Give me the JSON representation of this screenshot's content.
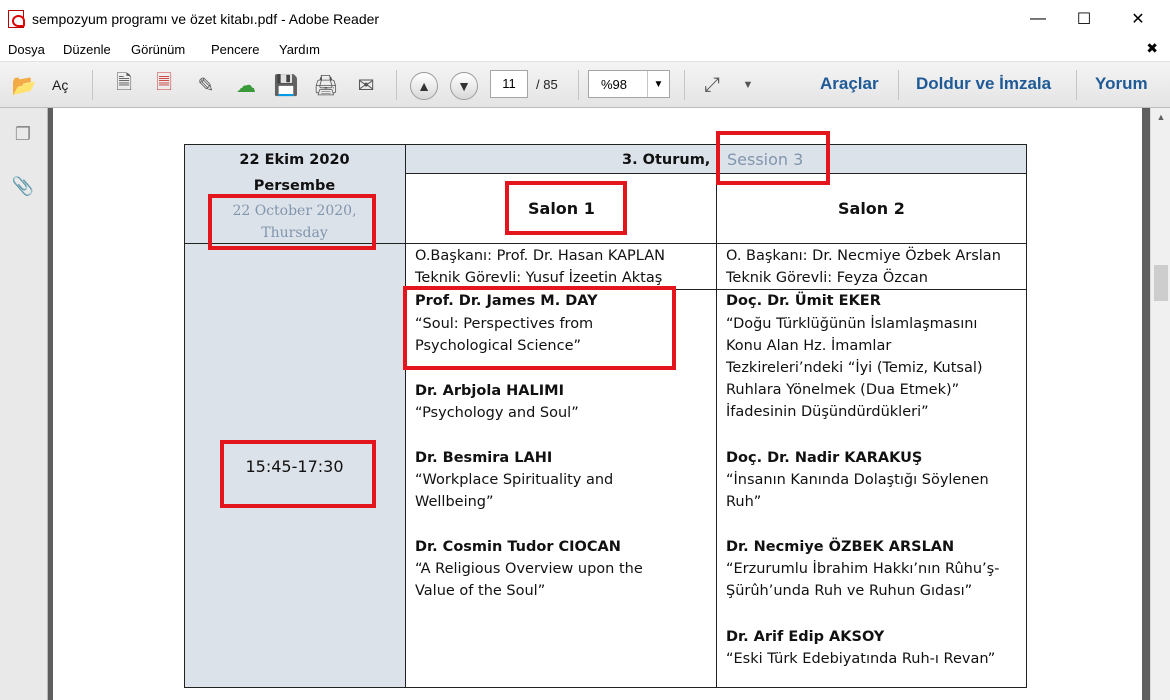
{
  "window": {
    "title": "sempozyum programı ve özet kitabı.pdf - Adobe Reader",
    "minimize": "—",
    "maximize": "☐",
    "close": "✕"
  },
  "menu": {
    "items": [
      "Dosya",
      "Düzenle",
      "Görünüm",
      "Pencere",
      "Yardım"
    ],
    "close_doc": "✖"
  },
  "toolbar": {
    "open_label": "Aç",
    "page_current": "11",
    "page_total": "/ 85",
    "zoom": "%98",
    "tools": "Araçlar",
    "fill_sign": "Doldur ve İmzala",
    "comment": "Yorum"
  },
  "table": {
    "date_line1": "22 Ekim 2020",
    "date_line2": "Persembe",
    "date_en_line1": "22 October 2020,",
    "date_en_line2": "Thursday",
    "session": "3. Oturum,",
    "session_en": "Session 3",
    "salon1": "Salon 1",
    "salon2": "Salon 2",
    "time": "15:45-17:30",
    "salon1_chair": "O.Başkanı: Prof. Dr. Hasan KAPLAN",
    "salon1_tech": "Teknik Görevli: Yusuf İzeetin Aktaş",
    "salon2_chair": "O. Başkanı: Dr. Necmiye Özbek Arslan",
    "salon2_tech": "Teknik Görevli: Feyza Özcan",
    "salon1_talks": [
      {
        "speaker": "Prof. Dr. James M. DAY",
        "title_lines": [
          "“Soul: Perspectives from",
          "Psychological Science”"
        ]
      },
      {
        "speaker": "Dr. Arbjola HALIMI",
        "title_lines": [
          "“Psychology and Soul”"
        ]
      },
      {
        "speaker": "Dr. Besmira LAHI",
        "title_lines": [
          "“Workplace Spirituality and",
          "Wellbeing”"
        ]
      },
      {
        "speaker": "Dr. Cosmin Tudor CIOCAN",
        "title_lines": [
          "“A Religious Overview upon the",
          "Value of the Soul”"
        ]
      }
    ],
    "salon2_talks": [
      {
        "speaker": "Doç. Dr. Ümit EKER",
        "title_lines": [
          "“Doğu Türklüğünün İslamlaşmasını",
          "Konu Alan Hz. İmamlar",
          "Tezkireleri’ndeki “İyi (Temiz, Kutsal)",
          "Ruhlara Yönelmek (Dua Etmek)”",
          "İfadesinin Düşündürdükleri”"
        ]
      },
      {
        "speaker": "Doç. Dr. Nadir KARAKUŞ",
        "title_lines": [
          "“İnsanın Kanında Dolaştığı Söylenen",
          "Ruh”"
        ]
      },
      {
        "speaker": "Dr. Necmiye ÖZBEK ARSLAN",
        "title_lines": [
          "“Erzurumlu İbrahim Hakkı’nın Rûhu’ş-",
          "Şürûh’unda Ruh ve Ruhun Gıdası”"
        ]
      },
      {
        "speaker": "Dr. Arif Edip AKSOY",
        "title_lines": [
          "“Eski Türk Edebiyatında Ruh-ı Revan”"
        ]
      }
    ]
  },
  "colors": {
    "highlight_box": "#e3161d",
    "header_shade": "#dce2ea",
    "link_blue": "#1f5a96",
    "english_grey": "#8195ad"
  }
}
